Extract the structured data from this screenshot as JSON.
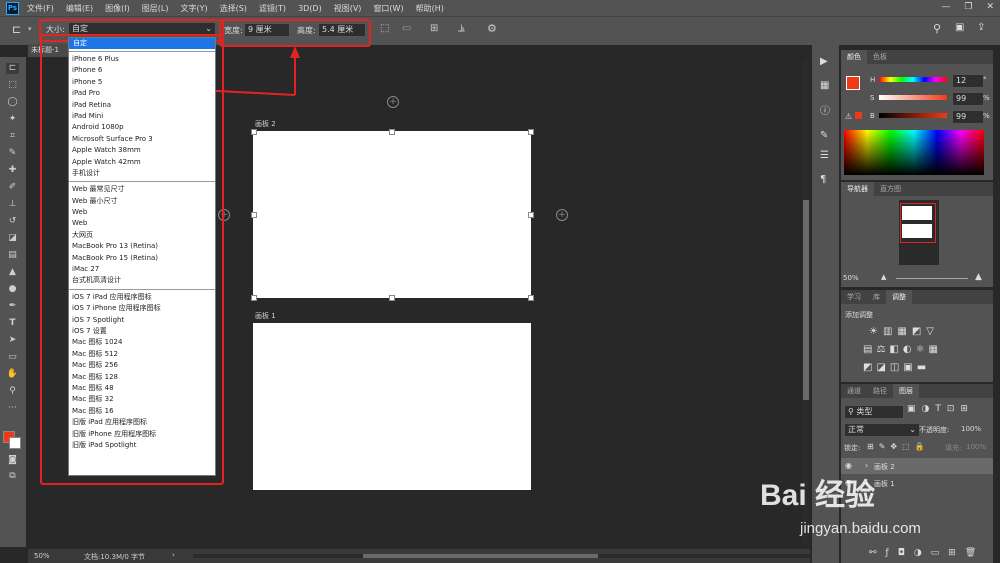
{
  "menu": {
    "logo": "Ps",
    "items": [
      "文件(F)",
      "编辑(E)",
      "图像(I)",
      "图层(L)",
      "文字(Y)",
      "选择(S)",
      "滤镜(T)",
      "3D(D)",
      "视图(V)",
      "窗口(W)",
      "帮助(H)"
    ]
  },
  "options": {
    "size_label": "大小:",
    "size_value": "自定",
    "width_label": "宽度:",
    "width_value": "9 厘米",
    "height_label": "高度:",
    "height_value": "5.4 厘米"
  },
  "doc_tab": "未标题-1",
  "dropdown": {
    "selected": "自定",
    "group1": [
      "iPhone 6 Plus",
      "iPhone 6",
      "iPhone 5",
      "iPad Pro",
      "iPad Retina",
      "iPad Mini",
      "Android 1080p",
      "Microsoft Surface Pro 3",
      "Apple Watch 38mm",
      "Apple Watch 42mm",
      "手机设计"
    ],
    "group2": [
      "Web 最常见尺寸",
      "Web 最小尺寸",
      "Web",
      "Web",
      "大网页",
      "MacBook Pro 13 (Retina)",
      "MacBook Pro 15 (Retina)",
      "iMac 27",
      "台式机高清设计"
    ],
    "group3": [
      "iOS 7 iPad 应用程序图标",
      "iOS 7 iPhone 应用程序图标",
      "iOS 7 Spotlight",
      "iOS 7 设置",
      "Mac 图标 1024",
      "Mac 图标 512",
      "Mac 图标 256",
      "Mac 图标 128",
      "Mac 图标 48",
      "Mac 图标 32",
      "Mac 图标 16",
      "旧版 iPad 应用程序图标",
      "旧版 iPhone 应用程序图标",
      "旧版 iPad Spotlight"
    ]
  },
  "artboards": {
    "top": "画板 2",
    "bottom": "画板 1"
  },
  "status": {
    "zoom": "50%",
    "doc": "文档:10.3M/0 字节"
  },
  "color_panel": {
    "tabs": [
      "颜色",
      "色板"
    ],
    "h_label": "H",
    "h_value": "12",
    "h_unit": "°",
    "s_label": "S",
    "s_value": "99",
    "s_unit": "%",
    "b_label": "B",
    "b_value": "99",
    "b_unit": "%",
    "foreground": "#f03a17",
    "background": "#ffffff"
  },
  "navigator": {
    "tabs": [
      "导航器",
      "直方图"
    ],
    "zoom": "50%"
  },
  "adjust_panel": {
    "tabs": [
      "学习",
      "库",
      "调整"
    ],
    "title": "添加调整"
  },
  "layers_panel": {
    "tabs": [
      "通道",
      "路径",
      "图层"
    ],
    "filter": "类型",
    "blend": "正常",
    "opacity_label": "不透明度:",
    "opacity_value": "100%",
    "lock_label": "锁定:",
    "fill_label": "填充:",
    "fill_value": "100%",
    "layers": [
      "画板 2",
      "画板 1"
    ]
  },
  "watermark": {
    "brand": "Bai 经验",
    "url": "jingyan.baidu.com"
  }
}
